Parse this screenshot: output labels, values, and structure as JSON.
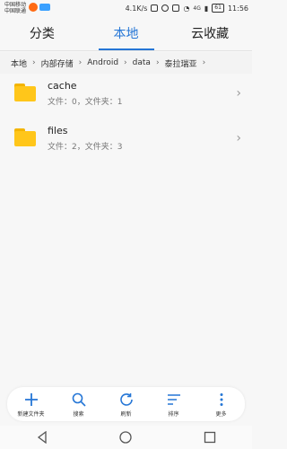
{
  "status_bar": {
    "carriers": [
      "中国移动",
      "中国联通"
    ],
    "speed": "4.1K/s",
    "network": "4G",
    "battery": "61",
    "time": "11:56"
  },
  "tabs": [
    {
      "label": "分类"
    },
    {
      "label": "本地"
    },
    {
      "label": "云收藏"
    }
  ],
  "breadcrumb": [
    "本地",
    "内部存储",
    "Android",
    "data",
    "泰拉瑞亚"
  ],
  "files": [
    {
      "name": "cache",
      "meta": "文件：0，文件夹：1"
    },
    {
      "name": "files",
      "meta": "文件：2，文件夹：3"
    }
  ],
  "toolbar": [
    {
      "icon": "plus-icon",
      "label": "新建文件夹"
    },
    {
      "icon": "search-icon",
      "label": "搜索"
    },
    {
      "icon": "refresh-icon",
      "label": "刷新"
    },
    {
      "icon": "sort-icon",
      "label": "排序"
    },
    {
      "icon": "more-icon",
      "label": "更多"
    }
  ],
  "colors": {
    "accent": "#2576d6",
    "folder": "#ffc61a"
  }
}
